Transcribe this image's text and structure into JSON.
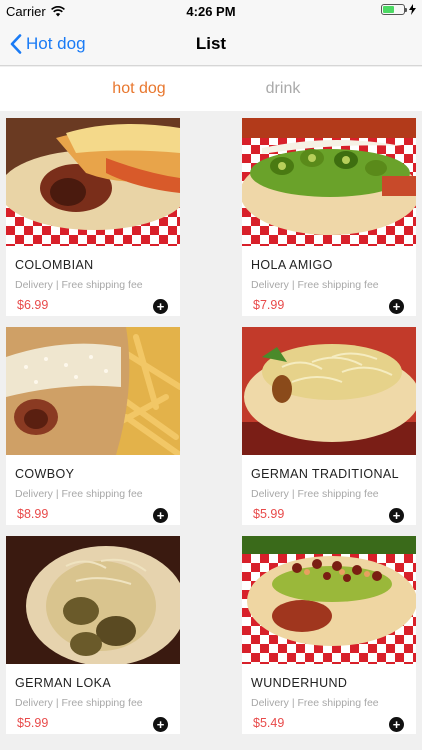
{
  "status_bar": {
    "carrier": "Carrier",
    "time": "4:26 PM",
    "battery_level": 0.55
  },
  "nav": {
    "back_label": "Hot dog",
    "title": "List"
  },
  "segments": [
    {
      "label": "hot dog",
      "active": true
    },
    {
      "label": "drink",
      "active": false
    }
  ],
  "colors": {
    "accent": "#e8772e",
    "price": "#e84a4a",
    "link": "#1a7bf5"
  },
  "products": [
    {
      "name": "COLOMBIAN",
      "subtitle": "Delivery | Free shipping fee",
      "price": "$6.99",
      "add_icon": "plus-circle-icon"
    },
    {
      "name": "HOLA AMIGO",
      "subtitle": "Delivery | Free shipping fee",
      "price": "$7.99",
      "add_icon": "plus-circle-icon"
    },
    {
      "name": "COWBOY",
      "subtitle": "Delivery | Free shipping fee",
      "price": "$8.99",
      "add_icon": "plus-circle-icon"
    },
    {
      "name": "GERMAN TRADITIONAL",
      "subtitle": "Delivery | Free shipping fee",
      "price": "$5.99",
      "add_icon": "plus-circle-icon"
    },
    {
      "name": "GERMAN LOKA",
      "subtitle": "Delivery | Free shipping fee",
      "price": "$5.99",
      "add_icon": "plus-circle-icon"
    },
    {
      "name": "WUNDERHUND",
      "subtitle": "Delivery | Free shipping fee",
      "price": "$5.49",
      "add_icon": "plus-circle-icon"
    }
  ]
}
